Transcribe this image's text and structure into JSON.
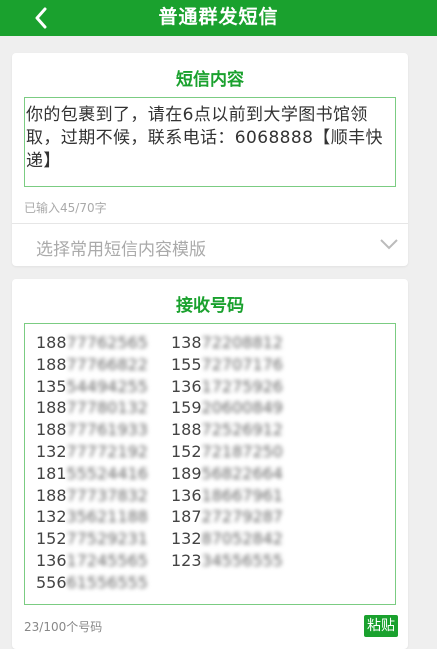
{
  "header": {
    "title": "普通群发短信"
  },
  "message_card": {
    "title": "短信内容",
    "content": "你的包裹到了，请在6点以前到大学图书馆领取，过期不候，联系电话：6068888【顺丰快递】",
    "char_count": "已输入45/70字",
    "template_placeholder": "选择常用短信内容模版"
  },
  "recipients_card": {
    "title": "接收号码",
    "numbers": [
      [
        "188",
        "77762565",
        "138",
        "72208812"
      ],
      [
        "188",
        "77766822",
        "155",
        "72707176"
      ],
      [
        "135",
        "54494255",
        "136",
        "17275926"
      ],
      [
        "188",
        "77780132",
        "159",
        "20600849"
      ],
      [
        "188",
        "77761933",
        "188",
        "72526912"
      ],
      [
        "132",
        "77772192",
        "152",
        "72187250"
      ],
      [
        "181",
        "55524416",
        "189",
        "56822664"
      ],
      [
        "188",
        "77737832",
        "136",
        "18667961"
      ],
      [
        "132",
        "35621188",
        "187",
        "27279287"
      ],
      [
        "152",
        "77529231",
        "132",
        "87052842"
      ],
      [
        "136",
        "17245565",
        "123",
        "34556555"
      ],
      [
        "556",
        "61556555",
        "",
        ""
      ]
    ],
    "number_count": "23/100个号码",
    "paste_label": "粘贴"
  }
}
